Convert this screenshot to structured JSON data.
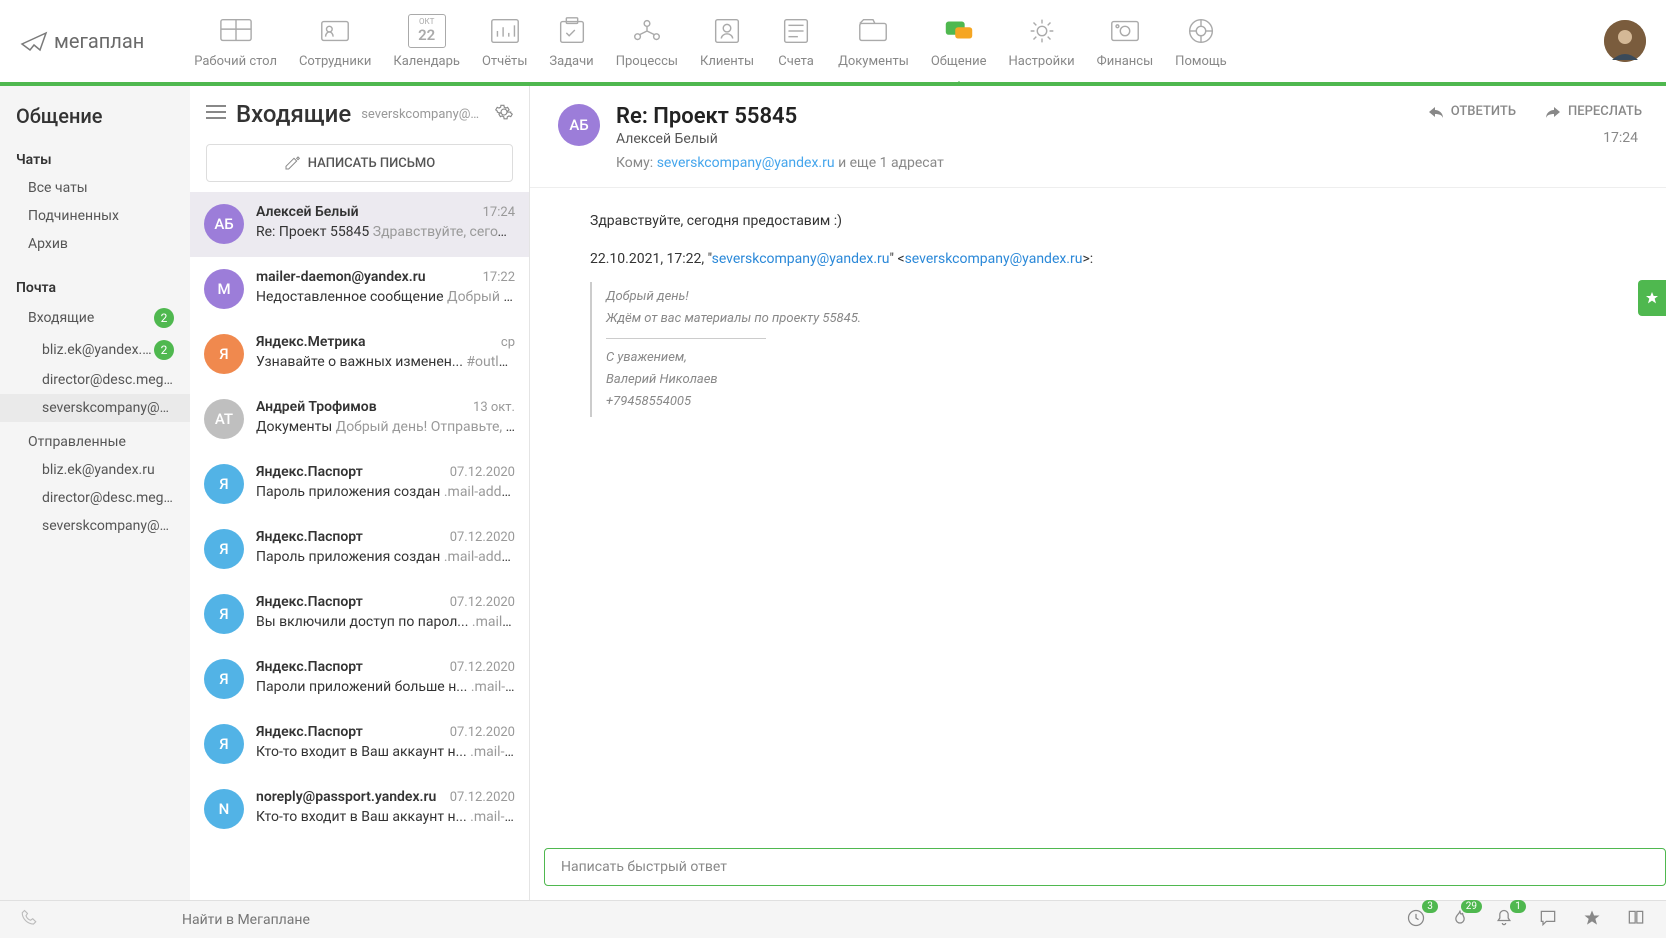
{
  "logo": "мегаплан",
  "nav": [
    {
      "label": "Рабочий стол"
    },
    {
      "label": "Сотрудники"
    },
    {
      "label": "Календарь",
      "day": "22",
      "month": "ОКТ"
    },
    {
      "label": "Отчёты"
    },
    {
      "label": "Задачи"
    },
    {
      "label": "Процессы"
    },
    {
      "label": "Клиенты"
    },
    {
      "label": "Счета"
    },
    {
      "label": "Документы"
    },
    {
      "label": "Общение",
      "active": true
    },
    {
      "label": "Настройки"
    },
    {
      "label": "Финансы"
    },
    {
      "label": "Помощь"
    }
  ],
  "sidebar": {
    "title": "Общение",
    "chats_label": "Чаты",
    "chats": [
      {
        "label": "Все чаты"
      },
      {
        "label": "Подчиненных"
      },
      {
        "label": "Архив"
      }
    ],
    "mail_label": "Почта",
    "inbox_label": "Входящие",
    "inbox_badge": "2",
    "inbox_accounts": [
      {
        "label": "bliz.ek@yandex.ru",
        "badge": "2"
      },
      {
        "label": "director@desc.megaplan.ru"
      },
      {
        "label": "severskcompany@yandex.ru",
        "selected": true
      }
    ],
    "sent_label": "Отправленные",
    "sent_accounts": [
      {
        "label": "bliz.ek@yandex.ru"
      },
      {
        "label": "director@desc.megaplan.ru"
      },
      {
        "label": "severskcompany@yandex.ru"
      }
    ]
  },
  "mail_list": {
    "title": "Входящие",
    "account": "severskcompany@yandex...",
    "compose": "НАПИСАТЬ ПИСЬМО",
    "items": [
      {
        "initials": "АБ",
        "color": "col-purple",
        "sender": "Алексей Белый",
        "time": "17:24",
        "subject": "Re: Проект 55845",
        "preview": "Здравствуйте, сегодня пре...",
        "selected": true
      },
      {
        "initials": "M",
        "color": "col-purple",
        "sender": "mailer-daemon@yandex.ru",
        "time": "17:22",
        "subject": "Недоставленное сообщение",
        "preview": "Добрый день! ..."
      },
      {
        "initials": "Я",
        "color": "col-orange",
        "sender": "Яндекс.Метрика",
        "time": "ср",
        "subject": "Узнавайте о важных изменен...",
        "preview": "#outlook a {..."
      },
      {
        "initials": "АТ",
        "color": "col-gray",
        "sender": "Андрей Трофимов",
        "time": "13 окт.",
        "subject": "Документы",
        "preview": "Добрый день! Отправьте, пожал..."
      },
      {
        "initials": "Я",
        "color": "col-blue",
        "sender": "Яндекс.Паспорт",
        "time": "07.12.2020",
        "subject": "Пароль приложения создан",
        "preview": ".mail-address a, ..."
      },
      {
        "initials": "Я",
        "color": "col-blue",
        "sender": "Яндекс.Паспорт",
        "time": "07.12.2020",
        "subject": "Пароль приложения создан",
        "preview": ".mail-address a, ..."
      },
      {
        "initials": "Я",
        "color": "col-blue",
        "sender": "Яндекс.Паспорт",
        "time": "07.12.2020",
        "subject": "Вы включили доступ по парол...",
        "preview": ".mail-addres..."
      },
      {
        "initials": "Я",
        "color": "col-blue",
        "sender": "Яндекс.Паспорт",
        "time": "07.12.2020",
        "subject": "Пароли приложений больше н...",
        "preview": ".mail-addres..."
      },
      {
        "initials": "Я",
        "color": "col-blue",
        "sender": "Яндекс.Паспорт",
        "time": "07.12.2020",
        "subject": "Кто-то входит в Ваш аккаунт н...",
        "preview": ".mail-addres..."
      },
      {
        "initials": "N",
        "color": "col-blue",
        "sender": "noreply@passport.yandex.ru",
        "time": "07.12.2020",
        "subject": "Кто-то входит в Ваш аккаунт н...",
        "preview": ".mail-addres..."
      }
    ]
  },
  "reader": {
    "actions": {
      "reply": "ОТВЕТИТЬ",
      "forward": "ПЕРЕСЛАТЬ"
    },
    "initials": "АБ",
    "subject": "Re: Проект 55845",
    "from": "Алексей Белый",
    "to_label": "Кому:",
    "to_email": "severskcompany@yandex.ru",
    "to_extra": "и еще 1 адресат",
    "time": "17:24",
    "greeting": "Здравствуйте, сегодня предоставим :)",
    "quote_dt": "22.10.2021, 17:22,",
    "quote_email": "severskcompany@yandex.ru",
    "quote": {
      "line1": "Добрый день!",
      "line2": "Ждём от вас материалы по проекту 55845.",
      "sig1": "С уважением,",
      "sig2": "Валерий Николаев",
      "sig3": "+79458554005"
    },
    "quick_reply": "Написать быстрый ответ"
  },
  "footer": {
    "search_placeholder": "Найти в Мегаплане",
    "badges": {
      "clock": "3",
      "fire": "29",
      "bell": "1"
    }
  }
}
